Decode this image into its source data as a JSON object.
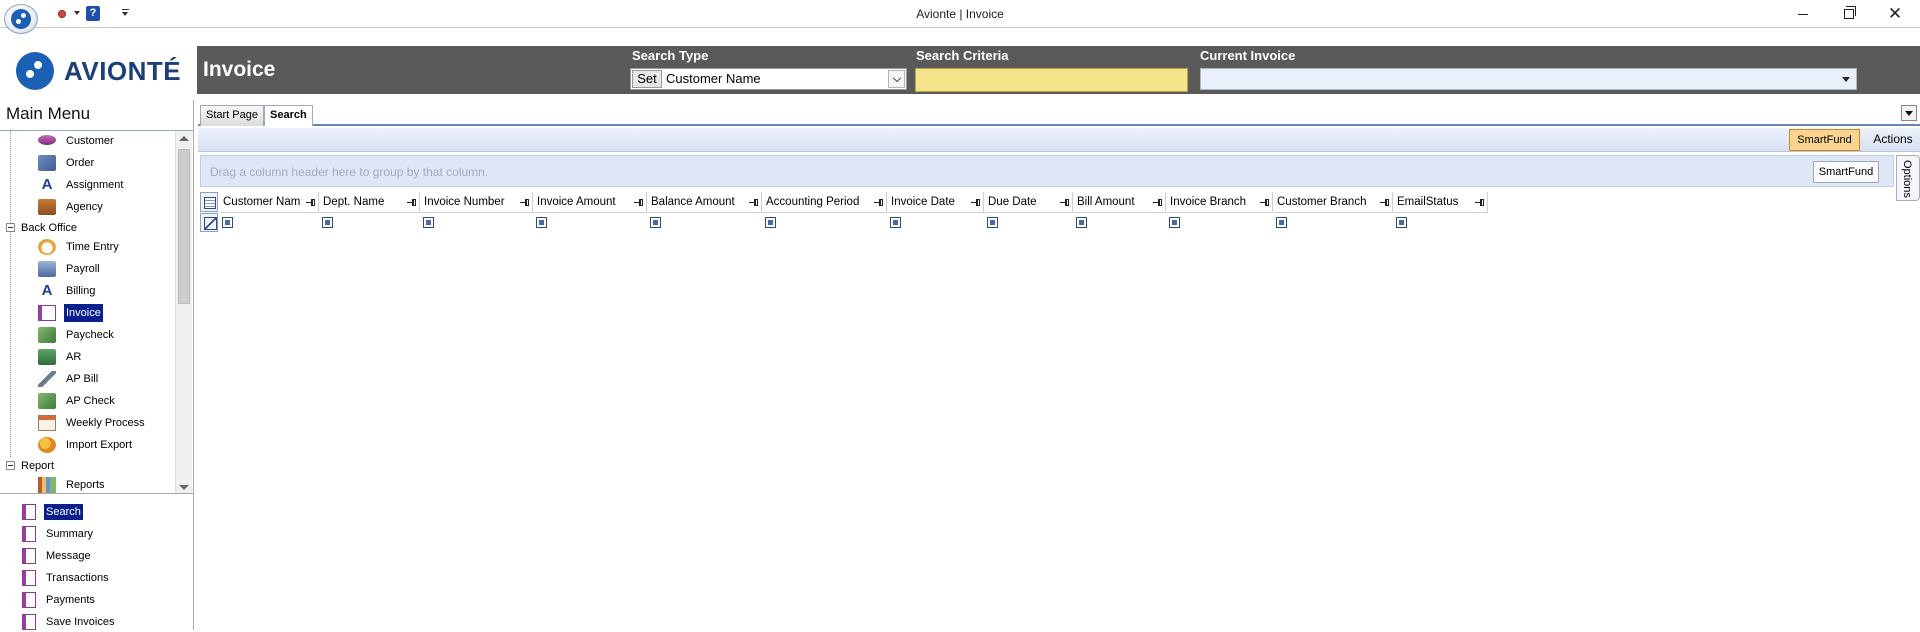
{
  "window": {
    "title": "Avionte | Invoice",
    "minimize_glyph": "",
    "restore_glyph": "",
    "close_glyph": "✕"
  },
  "quick_access": {
    "help_label": "?"
  },
  "brand": {
    "logo_text": "AVIONTÉ"
  },
  "header": {
    "module_title": "Invoice",
    "search_type_label": "Search Type",
    "search_type_set_label": "Set",
    "search_type_value": "Customer Name",
    "search_criteria_label": "Search Criteria",
    "search_criteria_value": "",
    "current_invoice_label": "Current Invoice",
    "current_invoice_value": ""
  },
  "sidebar": {
    "title": "Main Menu",
    "tree": [
      {
        "label": "Customer",
        "icon": "customer-icon"
      },
      {
        "label": "Order",
        "icon": "order-icon"
      },
      {
        "label": "Assignment",
        "icon": "assignment-icon"
      },
      {
        "label": "Agency",
        "icon": "agency-icon"
      }
    ],
    "back_office_label": "Back Office",
    "back_office": [
      {
        "label": "Time Entry",
        "icon": "time-entry-icon"
      },
      {
        "label": "Payroll",
        "icon": "payroll-icon"
      },
      {
        "label": "Billing",
        "icon": "billing-icon"
      },
      {
        "label": "Invoice",
        "icon": "invoice-icon",
        "selected": true
      },
      {
        "label": "Paycheck",
        "icon": "paycheck-icon"
      },
      {
        "label": "AR",
        "icon": "ar-icon"
      },
      {
        "label": "AP Bill",
        "icon": "ap-bill-icon"
      },
      {
        "label": "AP Check",
        "icon": "ap-check-icon"
      },
      {
        "label": "Weekly Process",
        "icon": "weekly-process-icon"
      },
      {
        "label": "Import Export",
        "icon": "import-export-icon"
      }
    ],
    "report_label": "Report",
    "report": [
      {
        "label": "Reports",
        "icon": "reports-icon"
      }
    ],
    "sub_items": [
      {
        "label": "Search",
        "selected": true
      },
      {
        "label": "Summary"
      },
      {
        "label": "Message"
      },
      {
        "label": "Transactions"
      },
      {
        "label": "Payments"
      },
      {
        "label": "Save Invoices"
      }
    ]
  },
  "tabs": [
    {
      "label": "Start Page"
    },
    {
      "label": "Search",
      "active": true
    }
  ],
  "actions": {
    "smartfund_label": "SmartFund",
    "actions_label": "Actions",
    "options_label": "Options",
    "group_hint": "Drag a column header here to group by that column.",
    "group_smartfund_label": "SmartFund"
  },
  "grid": {
    "columns": [
      "Customer Nam",
      "Dept. Name",
      "Invoice Number",
      "Invoice Amount",
      "Balance Amount",
      "Accounting Period",
      "Invoice Date",
      "Due Date",
      "Bill Amount",
      "Invoice Branch",
      "Customer Branch",
      "EmailStatus"
    ]
  }
}
